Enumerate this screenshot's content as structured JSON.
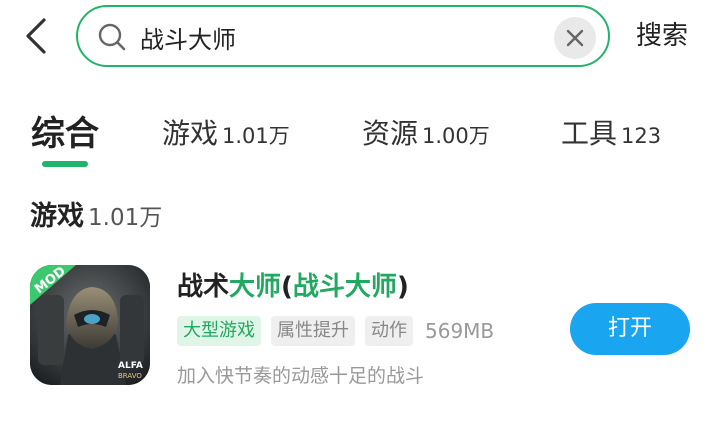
{
  "header": {
    "back_icon": "chevron-left-icon",
    "search": {
      "value": "战斗大师",
      "icon": "search-icon",
      "clear_icon": "close-icon"
    },
    "search_button_label": "搜索"
  },
  "tabs": [
    {
      "label": "综合",
      "count": "",
      "active": true
    },
    {
      "label": "游戏",
      "count": "1.01万",
      "active": false
    },
    {
      "label": "资源",
      "count": "1.00万",
      "active": false
    },
    {
      "label": "工具",
      "count": "123",
      "active": false
    }
  ],
  "section": {
    "label": "游戏",
    "count": "1.01万"
  },
  "app": {
    "title": {
      "part1": "战术",
      "part2": "大师",
      "part3": "(",
      "part4": "战斗大师",
      "part5": ")"
    },
    "icon_badge": "MOD",
    "icon_logo": "ALFA",
    "icon_logo_sub": "BRAVO",
    "tags": [
      "大型游戏",
      "属性提升",
      "动作"
    ],
    "size": "569MB",
    "description": "加入快节奏的动感十足的战斗",
    "action_label": "打开"
  },
  "colors": {
    "accent": "#22b46a",
    "highlight": "#22a95f",
    "button": "#1aa5f0"
  }
}
